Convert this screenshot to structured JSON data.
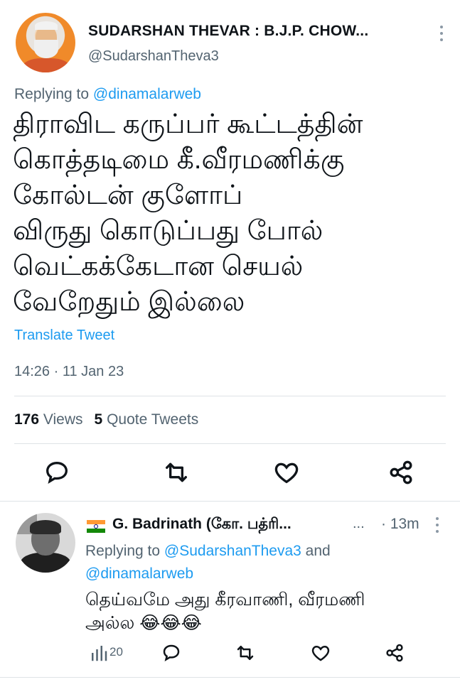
{
  "tweet": {
    "author": {
      "display_name": "SUDARSHAN THEVAR : B.J.P. CHOW...",
      "handle": "@SudarshanTheva3"
    },
    "replying": {
      "prefix": "Replying to ",
      "mention": "@dinamalarweb"
    },
    "text_lines": [
      "திராவிட கருப்பர் கூட்டத்தின்",
      "கொத்தடிமை கீ.வீரமணிக்கு",
      "கோல்டன் குளோப்",
      "விருது கொடுப்பது போல்",
      "வெட்கக்கேடான செயல்",
      "வேறேதும் இல்லை"
    ],
    "translate_label": "Translate Tweet",
    "timestamp": "14:26 · 11 Jan 23",
    "stats": {
      "views_count": "176",
      "views_label": "Views",
      "quotes_count": "5",
      "quotes_label": "Quote Tweets"
    },
    "icons": [
      "reply-icon",
      "retweet-icon",
      "like-icon",
      "share-icon",
      "more-icon"
    ]
  },
  "reply": {
    "author": {
      "display_name": "G. Badrinath (கோ. பத்ரி...",
      "ellipsis": "...",
      "time": "· 13m"
    },
    "replying": {
      "prefix": "Replying to ",
      "mention1": "@SudarshanTheva3",
      "and": " and",
      "mention2": "@dinamalarweb"
    },
    "text_lines": [
      "தெய்வமே அது கீரவாணி, வீரமணி",
      "அல்ல 😂😂😂"
    ],
    "views_count": "20",
    "icons": [
      "views-icon",
      "reply-icon",
      "retweet-icon",
      "like-icon",
      "share-icon",
      "india-flag-icon"
    ]
  },
  "colors": {
    "accent": "#1d9bf0",
    "secondary_text": "#536471",
    "primary_text": "#0f1419",
    "divider": "#dfe3e6"
  }
}
